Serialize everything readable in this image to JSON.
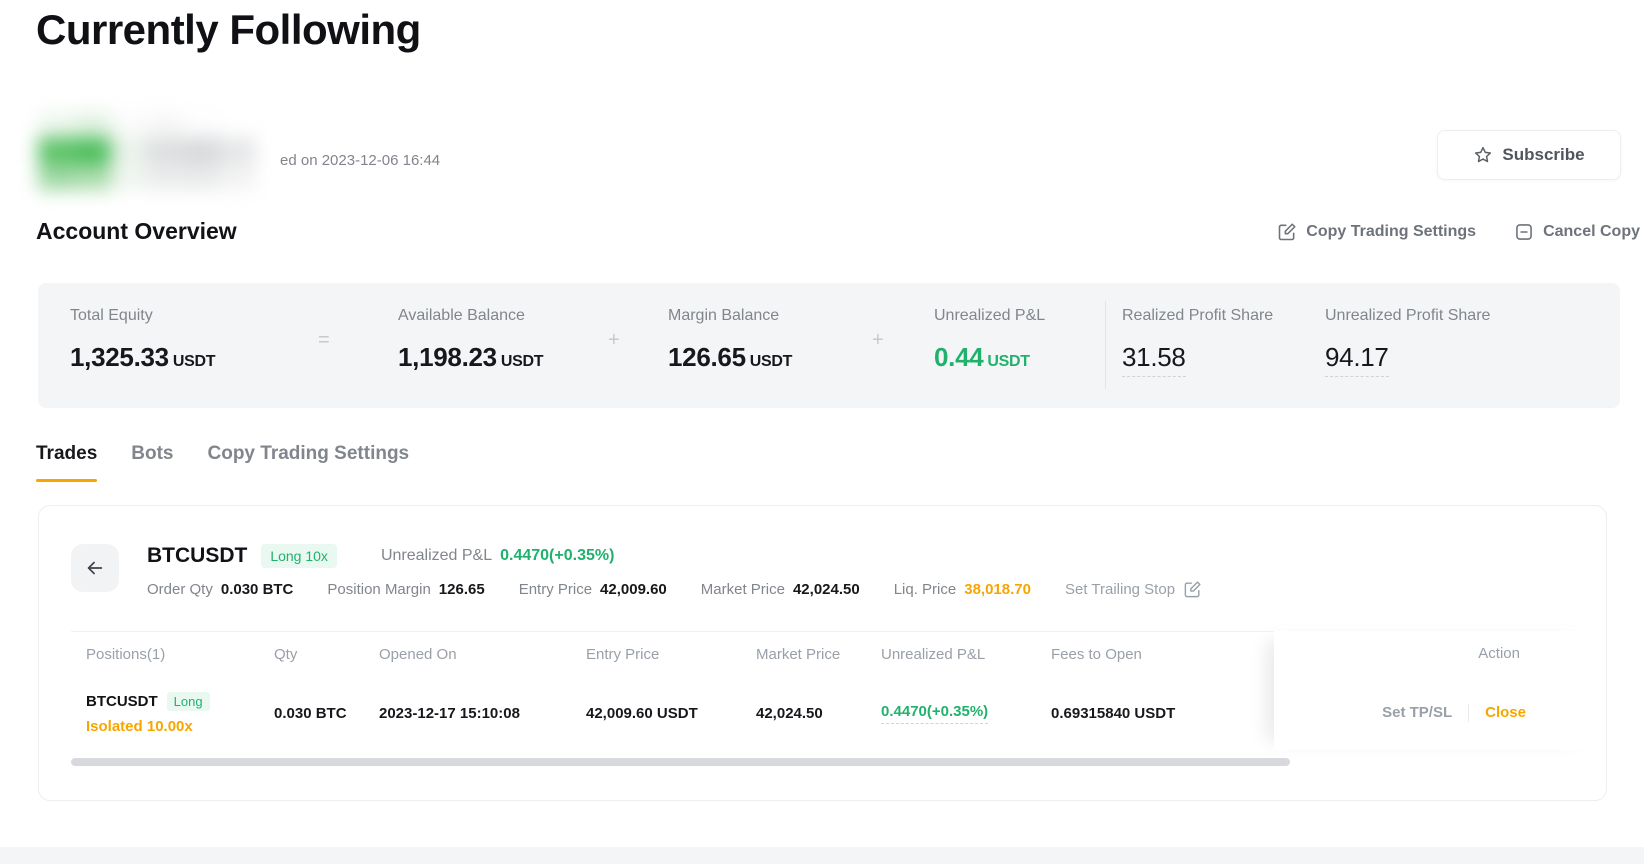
{
  "page": {
    "title": "Currently Following",
    "followed_on_text": "ed on 2023-12-06 16:44"
  },
  "header": {
    "subscribe_label": "Subscribe"
  },
  "account_overview": {
    "heading": "Account Overview",
    "copy_trading_settings_label": "Copy Trading Settings",
    "cancel_copy_label": "Cancel Copy",
    "equation": {
      "equals": "=",
      "plus": "+"
    },
    "stats": {
      "total_equity": {
        "label": "Total Equity",
        "value": "1,325.33",
        "unit": "USDT"
      },
      "available_balance": {
        "label": "Available Balance",
        "value": "1,198.23",
        "unit": "USDT"
      },
      "margin_balance": {
        "label": "Margin Balance",
        "value": "126.65",
        "unit": "USDT"
      },
      "unrealized_pnl": {
        "label": "Unrealized P&L",
        "value": "0.44",
        "unit": "USDT",
        "color": "#20b26c"
      },
      "realized_profit_share": {
        "label": "Realized Profit Share",
        "value": "31.58"
      },
      "unrealized_profit_share": {
        "label": "Unrealized Profit Share",
        "value": "94.17"
      }
    }
  },
  "tabs": [
    {
      "label": "Trades",
      "active": true
    },
    {
      "label": "Bots",
      "active": false
    },
    {
      "label": "Copy Trading Settings",
      "active": false
    }
  ],
  "trade_card": {
    "symbol": "BTCUSDT",
    "leverage_badge": "Long 10x",
    "unrealized_pnl_label": "Unrealized P&L",
    "unrealized_pnl_value": "0.4470(+0.35%)",
    "order_qty_label": "Order Qty",
    "order_qty_value": "0.030 BTC",
    "position_margin_label": "Position Margin",
    "position_margin_value": "126.65",
    "entry_price_label": "Entry Price",
    "entry_price_value": "42,009.60",
    "market_price_label": "Market Price",
    "market_price_value": "42,024.50",
    "liq_price_label": "Liq. Price",
    "liq_price_value": "38,018.70",
    "set_trailing_stop_label": "Set Trailing Stop"
  },
  "positions_table": {
    "headers": {
      "positions": "Positions(1)",
      "qty": "Qty",
      "opened_on": "Opened On",
      "entry_price": "Entry Price",
      "market_price": "Market Price",
      "unrealized_pnl": "Unrealized P&L",
      "fees_to_open": "Fees to Open",
      "action": "Action"
    },
    "row": {
      "symbol": "BTCUSDT",
      "side": "Long",
      "margin_mode": "Isolated 10.00x",
      "qty": "0.030 BTC",
      "opened_on": "2023-12-17 15:10:08",
      "entry_price": "42,009.60 USDT",
      "market_price": "42,024.50",
      "unrealized_pnl": "0.4470(+0.35%)",
      "fees_to_open": "0.69315840 USDT",
      "set_tpsl_label": "Set TP/SL",
      "close_label": "Close"
    }
  },
  "colors": {
    "green": "#20b26c",
    "orange": "#f7a600",
    "label_gray": "#81858c"
  }
}
